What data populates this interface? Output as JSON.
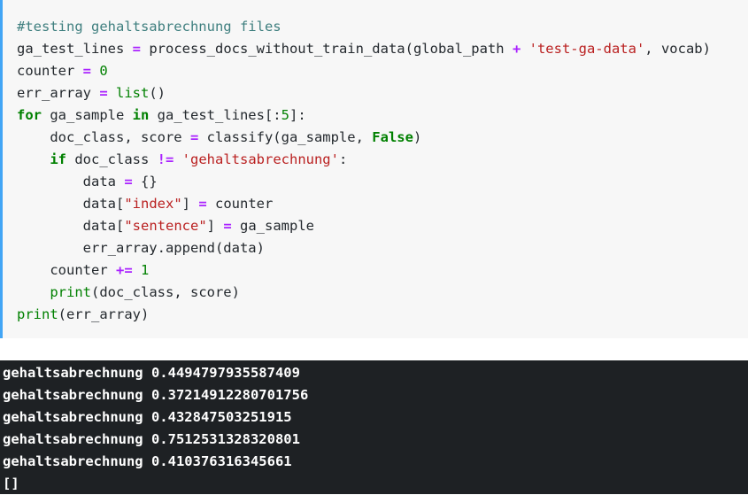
{
  "code_cell": {
    "lines": [
      {
        "tokens": [
          {
            "t": "comment",
            "v": "#testing gehaltsabrechnung files"
          }
        ]
      },
      {
        "tokens": [
          {
            "t": "plain",
            "v": "ga_test_lines "
          },
          {
            "t": "op",
            "v": "="
          },
          {
            "t": "plain",
            "v": " process_docs_without_train_data(global_path "
          },
          {
            "t": "op",
            "v": "+"
          },
          {
            "t": "plain",
            "v": " "
          },
          {
            "t": "str",
            "v": "'test-ga-data'"
          },
          {
            "t": "plain",
            "v": ", vocab)"
          }
        ]
      },
      {
        "tokens": [
          {
            "t": "plain",
            "v": "counter "
          },
          {
            "t": "op",
            "v": "="
          },
          {
            "t": "plain",
            "v": " "
          },
          {
            "t": "num",
            "v": "0"
          }
        ]
      },
      {
        "tokens": [
          {
            "t": "plain",
            "v": "err_array "
          },
          {
            "t": "op",
            "v": "="
          },
          {
            "t": "plain",
            "v": " "
          },
          {
            "t": "builtin",
            "v": "list"
          },
          {
            "t": "plain",
            "v": "()"
          }
        ]
      },
      {
        "tokens": [
          {
            "t": "kw",
            "v": "for"
          },
          {
            "t": "plain",
            "v": " ga_sample "
          },
          {
            "t": "kw",
            "v": "in"
          },
          {
            "t": "plain",
            "v": " ga_test_lines[:"
          },
          {
            "t": "num",
            "v": "5"
          },
          {
            "t": "plain",
            "v": "]:"
          }
        ]
      },
      {
        "tokens": [
          {
            "t": "plain",
            "v": "    doc_class, score "
          },
          {
            "t": "op",
            "v": "="
          },
          {
            "t": "plain",
            "v": " classify(ga_sample, "
          },
          {
            "t": "kw",
            "v": "False"
          },
          {
            "t": "plain",
            "v": ")"
          }
        ]
      },
      {
        "tokens": [
          {
            "t": "plain",
            "v": "    "
          },
          {
            "t": "kw",
            "v": "if"
          },
          {
            "t": "plain",
            "v": " doc_class "
          },
          {
            "t": "op",
            "v": "!="
          },
          {
            "t": "plain",
            "v": " "
          },
          {
            "t": "str",
            "v": "'gehaltsabrechnung'"
          },
          {
            "t": "plain",
            "v": ":"
          }
        ]
      },
      {
        "tokens": [
          {
            "t": "plain",
            "v": "        data "
          },
          {
            "t": "op",
            "v": "="
          },
          {
            "t": "plain",
            "v": " {}"
          }
        ]
      },
      {
        "tokens": [
          {
            "t": "plain",
            "v": "        data["
          },
          {
            "t": "str",
            "v": "\"index\""
          },
          {
            "t": "plain",
            "v": "] "
          },
          {
            "t": "op",
            "v": "="
          },
          {
            "t": "plain",
            "v": " counter"
          }
        ]
      },
      {
        "tokens": [
          {
            "t": "plain",
            "v": "        data["
          },
          {
            "t": "str",
            "v": "\"sentence\""
          },
          {
            "t": "plain",
            "v": "] "
          },
          {
            "t": "op",
            "v": "="
          },
          {
            "t": "plain",
            "v": " ga_sample"
          }
        ]
      },
      {
        "tokens": [
          {
            "t": "plain",
            "v": "        err_array.append(data)"
          }
        ]
      },
      {
        "tokens": [
          {
            "t": "plain",
            "v": "    counter "
          },
          {
            "t": "op",
            "v": "+="
          },
          {
            "t": "plain",
            "v": " "
          },
          {
            "t": "num",
            "v": "1"
          }
        ]
      },
      {
        "tokens": [
          {
            "t": "plain",
            "v": "    "
          },
          {
            "t": "builtin",
            "v": "print"
          },
          {
            "t": "plain",
            "v": "(doc_class, score)"
          }
        ]
      },
      {
        "tokens": [
          {
            "t": "builtin",
            "v": "print"
          },
          {
            "t": "plain",
            "v": "(err_array)"
          }
        ]
      }
    ]
  },
  "output_cell": {
    "lines": [
      "gehaltsabrechnung 0.4494797935587409",
      "gehaltsabrechnung 0.37214912280701756",
      "gehaltsabrechnung 0.432847503251915",
      "gehaltsabrechnung 0.7512531328320801",
      "gehaltsabrechnung 0.410376316345661",
      "[]"
    ]
  },
  "colors": {
    "accent_border": "#42a5f5",
    "code_bg": "#f7f7f7",
    "output_bg": "#1e2124"
  }
}
